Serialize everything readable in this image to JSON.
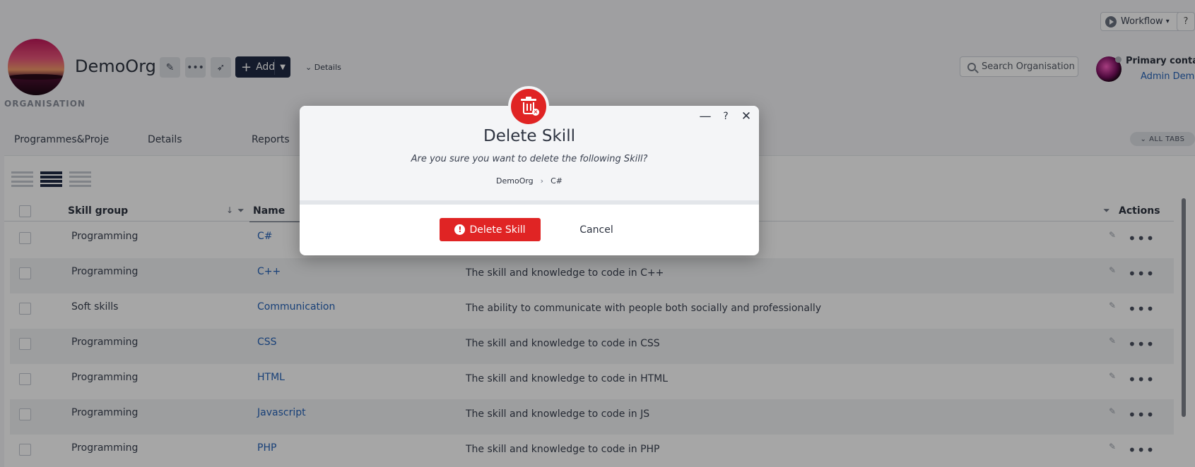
{
  "topbar": {
    "workflow_label": "Workflow",
    "help_label": "?"
  },
  "org": {
    "name": "DemoOrg",
    "type_label": "ORGANISATION",
    "add_label": "Add",
    "details_label": "Details"
  },
  "search": {
    "placeholder": "Search Organisation"
  },
  "contact": {
    "title": "Primary contact",
    "name": "Admin Demo"
  },
  "tabs": [
    {
      "label": "Programmes&Proje"
    },
    {
      "label": "Details"
    },
    {
      "label": "Reports"
    }
  ],
  "all_tabs_label": "ALL TABS",
  "grid": {
    "columns": {
      "skill_group": "Skill group",
      "name": "Name",
      "actions": "Actions"
    },
    "rows": [
      {
        "group": "Programming",
        "name": "C#",
        "description": ""
      },
      {
        "group": "Programming",
        "name": "C++",
        "description": "The skill and knowledge to code in C++"
      },
      {
        "group": "Soft skills",
        "name": "Communication",
        "description": "The ability to communicate with people both socially and professionally"
      },
      {
        "group": "Programming",
        "name": "CSS",
        "description": "The skill and knowledge to code in CSS"
      },
      {
        "group": "Programming",
        "name": "HTML",
        "description": "The skill and knowledge to code in HTML"
      },
      {
        "group": "Programming",
        "name": "Javascript",
        "description": "The skill and knowledge to code in JS"
      },
      {
        "group": "Programming",
        "name": "PHP",
        "description": "The skill and knowledge to code in PHP"
      }
    ]
  },
  "modal": {
    "title": "Delete Skill",
    "message": "Are you sure you want to delete the following Skill?",
    "crumb_org": "DemoOrg",
    "crumb_item": "C#",
    "minimize_label": "—",
    "help_label": "?",
    "close_label": "✕",
    "delete_label": "Delete Skill",
    "cancel_label": "Cancel"
  },
  "colors": {
    "accent_red": "#e02424",
    "navy": "#1f2a44",
    "link_blue": "#2563b8"
  },
  "icons": [
    "pencil-icon",
    "more-icon",
    "rocket-icon",
    "plus-icon",
    "search-icon",
    "trash-icon",
    "warning-icon",
    "close-icon"
  ]
}
